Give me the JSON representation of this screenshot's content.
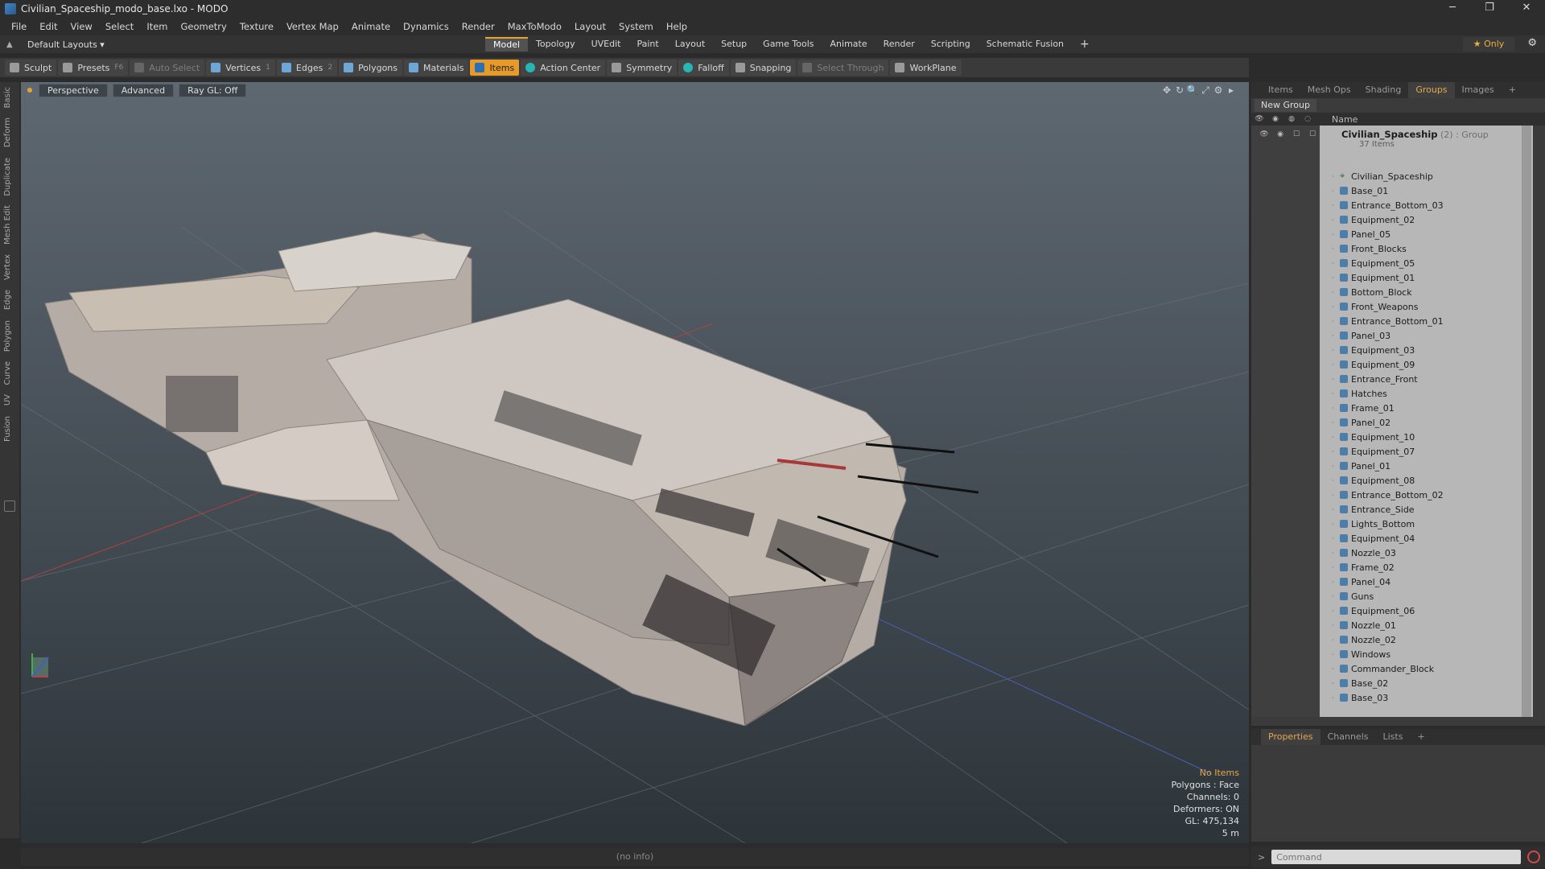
{
  "titlebar": {
    "title": "Civilian_Spaceship_modo_base.lxo - MODO",
    "min": "─",
    "max": "❐",
    "close": "✕"
  },
  "menu": [
    "File",
    "Edit",
    "View",
    "Select",
    "Item",
    "Geometry",
    "Texture",
    "Vertex Map",
    "Animate",
    "Dynamics",
    "Render",
    "MaxToModo",
    "Layout",
    "System",
    "Help"
  ],
  "layoutbar": {
    "layouts_label": "Default Layouts ▾",
    "tabs": [
      "Model",
      "Topology",
      "UVEdit",
      "Paint",
      "Layout",
      "Setup",
      "Game Tools",
      "Animate",
      "Render",
      "Scripting",
      "Schematic Fusion"
    ],
    "active_tab": "Model",
    "plus": "+",
    "only_label": "★  Only",
    "gear": "⚙"
  },
  "toolbar": {
    "sculpt": "Sculpt",
    "presets": "Presets",
    "presets_key": "F6",
    "auto_select": "Auto Select",
    "vertices": "Vertices",
    "vertices_key": "1",
    "edges": "Edges",
    "edges_key": "2",
    "polygons": "Polygons",
    "materials": "Materials",
    "items": "Items",
    "action_center": "Action Center",
    "symmetry": "Symmetry",
    "falloff": "Falloff",
    "snapping": "Snapping",
    "select_through": "Select Through",
    "workplane": "WorkPlane"
  },
  "lefttabs": [
    "Basic",
    "Deform",
    "Duplicate",
    "Mesh Edit",
    "Vertex",
    "Edge",
    "Polygon",
    "Curve",
    "UV",
    "Fusion"
  ],
  "viewport": {
    "view": "Perspective",
    "shading": "Advanced",
    "raygl": "Ray GL: Off",
    "icons": [
      "✥",
      "↻",
      "🔍",
      "⤢",
      "⚙",
      "▸"
    ],
    "stats": {
      "items": "No Items",
      "polygons": "Polygons : Face",
      "channels": "Channels: 0",
      "deformers": "Deformers: ON",
      "gl": "GL: 475,134",
      "scale": "5 m"
    }
  },
  "statusbar": {
    "info": "(no info)"
  },
  "rightpanel": {
    "tabs": [
      "Items",
      "Mesh Ops",
      "Shading",
      "Groups",
      "Images",
      "+"
    ],
    "active_tab": "Groups",
    "new_group": "New Group",
    "col_name": "Name",
    "root": {
      "name": "Civilian_Spaceship",
      "meta": "(2) : Group",
      "count": "37 Items"
    },
    "items": [
      "Civilian_Spaceship",
      "Base_01",
      "Entrance_Bottom_03",
      "Equipment_02",
      "Panel_05",
      "Front_Blocks",
      "Equipment_05",
      "Equipment_01",
      "Bottom_Block",
      "Front_Weapons",
      "Entrance_Bottom_01",
      "Panel_03",
      "Equipment_03",
      "Equipment_09",
      "Entrance_Front",
      "Hatches",
      "Frame_01",
      "Panel_02",
      "Equipment_10",
      "Equipment_07",
      "Panel_01",
      "Equipment_08",
      "Entrance_Bottom_02",
      "Entrance_Side",
      "Lights_Bottom",
      "Equipment_04",
      "Nozzle_03",
      "Frame_02",
      "Panel_04",
      "Guns",
      "Equipment_06",
      "Nozzle_01",
      "Nozzle_02",
      "Windows",
      "Commander_Block",
      "Base_02",
      "Base_03"
    ]
  },
  "proppanel": {
    "tabs": [
      "Properties",
      "Channels",
      "Lists",
      "+"
    ],
    "active_tab": "Properties"
  },
  "command": {
    "placeholder": "Command",
    "chevron": ">"
  },
  "colors": {
    "accent": "#e59a2a",
    "viewport_top": "#5e6870",
    "tree_bg": "#b7b7b7"
  }
}
